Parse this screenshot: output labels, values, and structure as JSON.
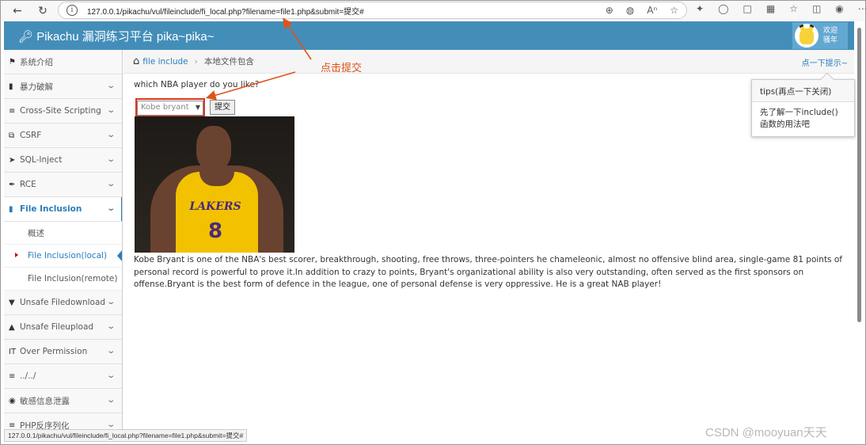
{
  "browser": {
    "url": "127.0.0.1/pikachu/vul/fileinclude/fi_local.php?filename=file1.php&submit=提交#"
  },
  "app": {
    "brand": "Pikachu 漏洞练习平台 pika~pika~",
    "user_greeting_1": "欢迎",
    "user_greeting_2": "骚年"
  },
  "sidebar": {
    "items": [
      {
        "label": "系统介绍",
        "icon": "tag-icon"
      },
      {
        "label": "暴力破解",
        "icon": "lock-icon"
      },
      {
        "label": "Cross-Site Scripting",
        "icon": "sliders-icon"
      },
      {
        "label": "CSRF",
        "icon": "share-icon"
      },
      {
        "label": "SQL-Inject",
        "icon": "plane-icon"
      },
      {
        "label": "RCE",
        "icon": "wrench-icon"
      },
      {
        "label": "File Inclusion",
        "icon": "file-icon"
      },
      {
        "label": "Unsafe Filedownload",
        "icon": "download-icon"
      },
      {
        "label": "Unsafe Fileupload",
        "icon": "upload-icon"
      },
      {
        "label": "Over Permission",
        "icon": "text-height-icon"
      },
      {
        "label": "../../",
        "icon": "list-icon"
      },
      {
        "label": "敏感信息泄露",
        "icon": "camera-icon"
      },
      {
        "label": "PHP反序列化",
        "icon": "list-icon"
      }
    ],
    "sub_items": [
      "概述",
      "File Inclusion(local)",
      "File Inclusion(remote)"
    ]
  },
  "breadcrumb": {
    "link": "file include",
    "current": "本地文件包含",
    "hint": "点一下提示~"
  },
  "main": {
    "question": "which NBA player do you like?",
    "select_value": "Kobe bryant",
    "submit_label": "提交",
    "jersey_text": "LAKERS",
    "jersey_number": "8",
    "description": "Kobe Bryant is one of the NBA's best scorer, breakthrough, shooting, free throws, three-pointers he chameleonic, almost no offensive blind area, single-game 81 points of personal record is powerful to prove it.In addition to crazy to points, Bryant's organizational ability is also very outstanding, often served as the first sponsors on offense.Bryant is the best form of defence in the league, one of personal defense is very oppressive. He is a great NAB player!"
  },
  "annotation": {
    "label": "点击提交",
    "color": "#e0521a"
  },
  "tips": {
    "title": "tips(再点一下关闭)",
    "body": "先了解一下include()函数的用法吧"
  },
  "status_bar": "127.0.0.1/pikachu/vul/fileinclude/fi_local.php?filename=file1.php&submit=提交#",
  "watermark": "CSDN @mooyuan天天"
}
